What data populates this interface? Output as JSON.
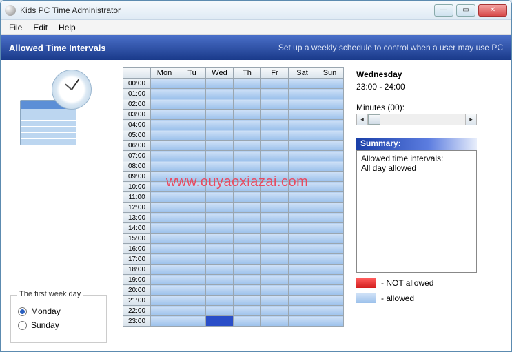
{
  "window": {
    "title": "Kids PC Time Administrator"
  },
  "menu": {
    "file": "File",
    "edit": "Edit",
    "help": "Help"
  },
  "header": {
    "title": "Allowed Time Intervals",
    "subtitle": "Set up a weekly schedule to control when a user may use PC"
  },
  "days": [
    "Mon",
    "Tu",
    "Wed",
    "Th",
    "Fr",
    "Sat",
    "Sun"
  ],
  "hours": [
    "00:00",
    "01:00",
    "02:00",
    "03:00",
    "04:00",
    "05:00",
    "06:00",
    "07:00",
    "08:00",
    "09:00",
    "10:00",
    "11:00",
    "12:00",
    "13:00",
    "14:00",
    "15:00",
    "16:00",
    "17:00",
    "18:00",
    "19:00",
    "20:00",
    "21:00",
    "22:00",
    "23:00"
  ],
  "selected": {
    "day_index": 2,
    "hour_index": 23
  },
  "first_day": {
    "legend": "The first week day",
    "monday": "Monday",
    "sunday": "Sunday",
    "selected": "monday"
  },
  "detail": {
    "day_name": "Wednesday",
    "range": "23:00 - 24:00",
    "minutes_label": "Minutes (00):"
  },
  "summary": {
    "header": "Summary:",
    "line1": "Allowed time intervals:",
    "line2": "All day allowed"
  },
  "legend": {
    "not_allowed": "- NOT allowed",
    "allowed": "- allowed"
  },
  "watermark": "www.ouyaoxiazai.com"
}
